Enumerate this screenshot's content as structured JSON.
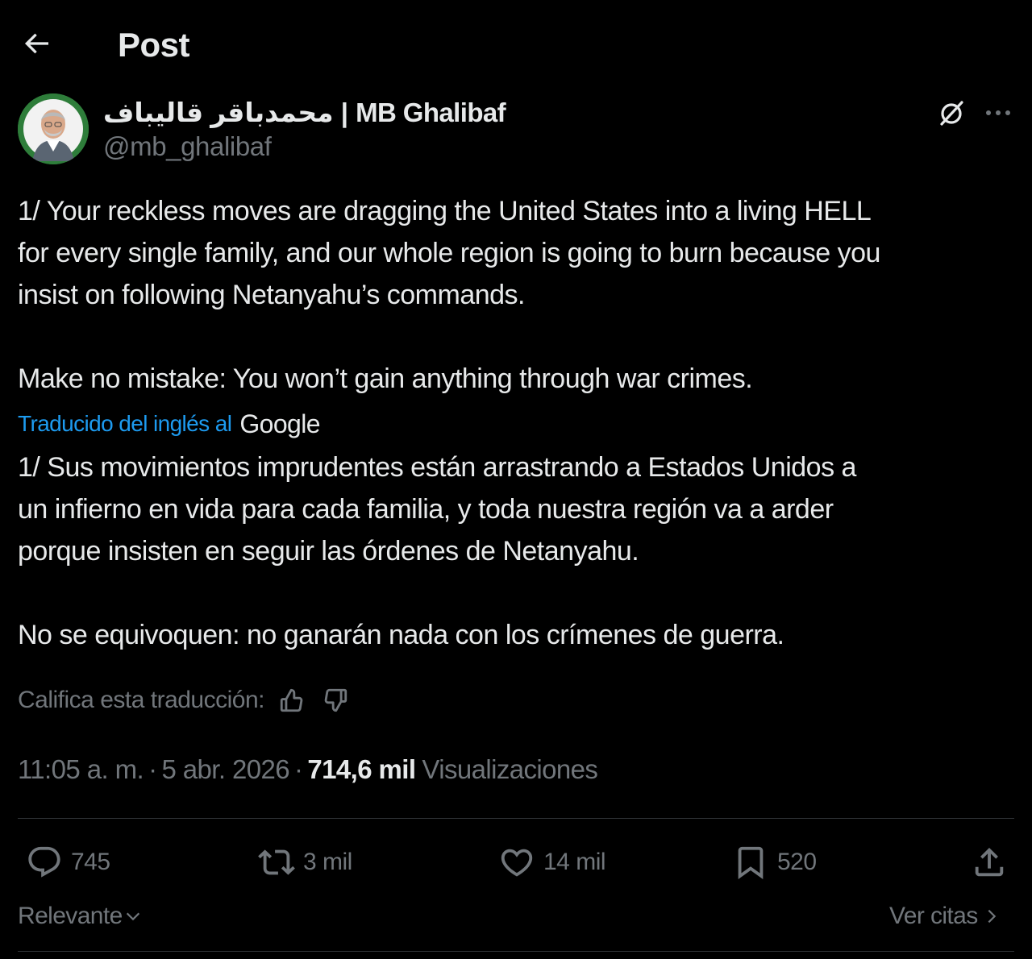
{
  "header": {
    "title": "Post",
    "back_icon": "arrow-left-icon"
  },
  "author": {
    "display_name": "محمدباقر قالیباف | MB Ghalibaf",
    "handle": "@mb_ghalibaf",
    "avatar_bg": "#2e7d3a"
  },
  "tweet": {
    "original_text": "1/ Your reckless moves are dragging the United States into a living HELL\nfor every single family, and our whole region is going to burn because you\ninsist on following Netanyahu’s commands.\n\nMake no mistake: You won’t gain anything through war crimes.",
    "translated_by_label": "Traducido del inglés al",
    "translator": "Google",
    "translated_text": "1/ Sus movimientos imprudentes están arrastrando a Estados Unidos a\nun infierno en vida para cada familia, y toda nuestra región va a arder\nporque insisten en seguir las órdenes de Netanyahu.\n\nNo se equivoquen: no ganarán nada con los crímenes de guerra.",
    "rate_label": "Califica esta traducción:"
  },
  "meta": {
    "time": "11:05 a. m.",
    "separator": "·",
    "date": "5 abr. 2026",
    "views_count": "714,6 mil",
    "views_label": "Visualizaciones"
  },
  "actions": {
    "replies": "745",
    "reposts": "3 mil",
    "likes": "14 mil",
    "bookmarks": "520"
  },
  "footer": {
    "sort_label": "Relevante",
    "quotes_label": "Ver citas"
  },
  "colors": {
    "background": "#000000",
    "text": "#e7e9ea",
    "muted": "#71767b",
    "accent": "#1d9bf0",
    "divider": "#2f3336"
  }
}
